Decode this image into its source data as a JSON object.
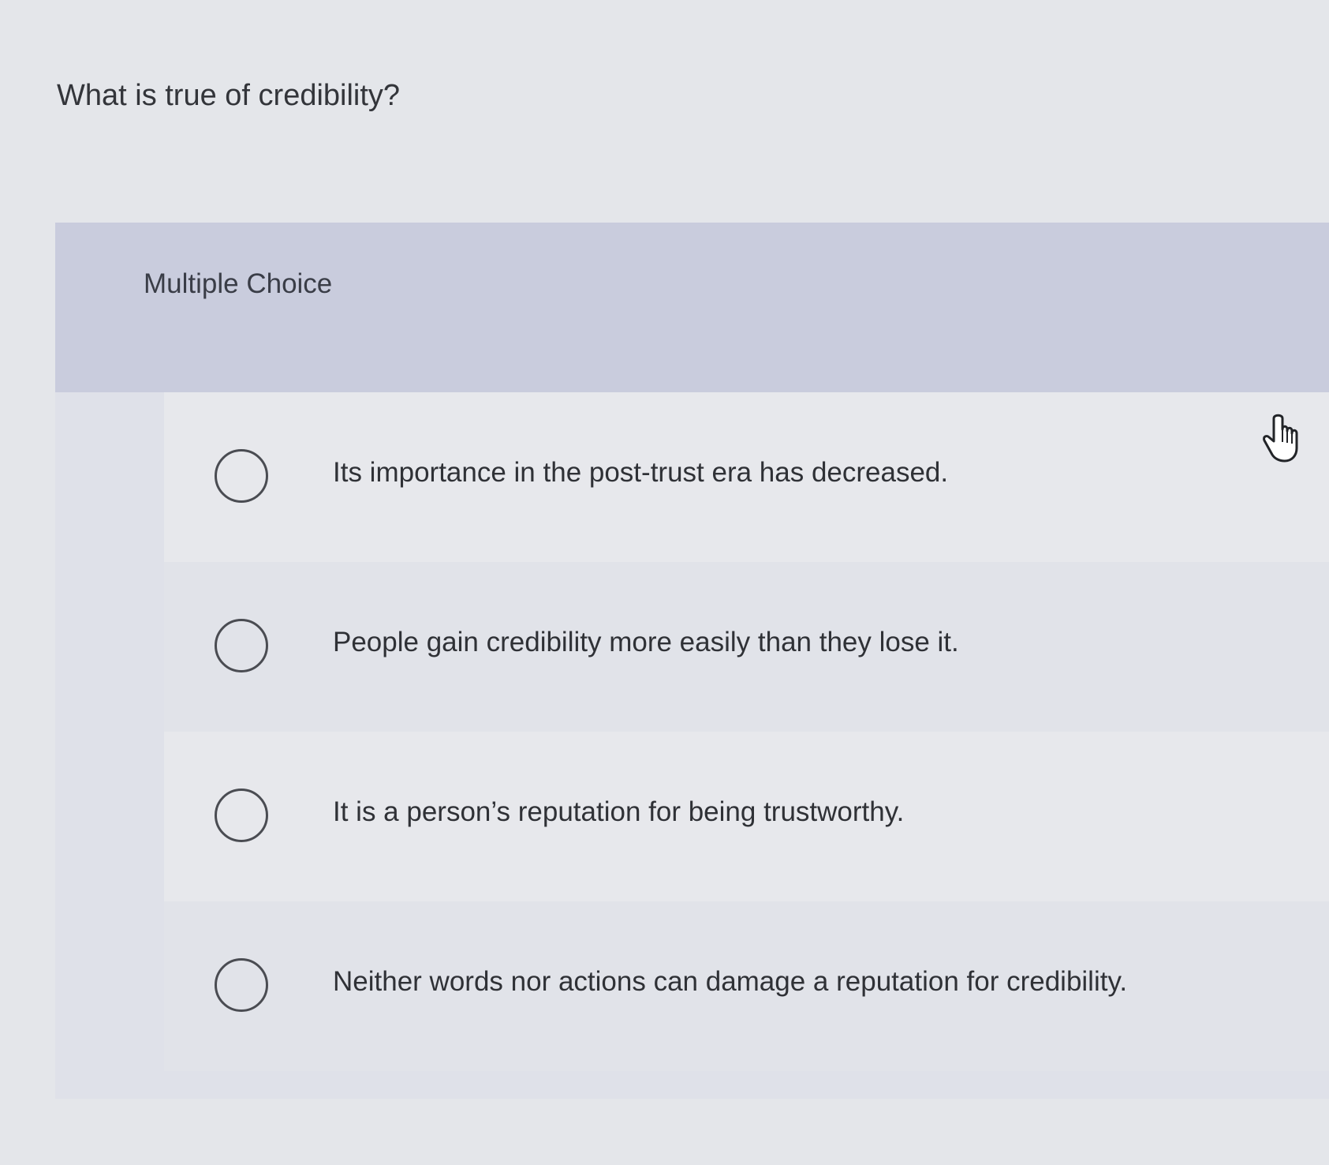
{
  "question": {
    "text": "What is true of credibility?"
  },
  "section": {
    "label": "Multiple Choice"
  },
  "options": [
    {
      "label": "Its importance in the post-trust era has decreased."
    },
    {
      "label": "People gain credibility more easily than they lose it."
    },
    {
      "label": "It is a person’s reputation for being trustworthy."
    },
    {
      "label": "Neither words nor actions can damage a reputation for credibility."
    }
  ],
  "cursor": {
    "icon": "hand-pointer-icon"
  }
}
